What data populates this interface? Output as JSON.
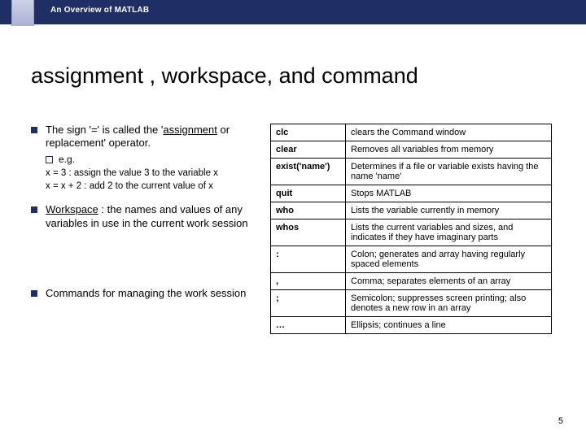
{
  "header": {
    "title": "An Overview of MATLAB"
  },
  "title": "assignment , workspace, and command",
  "bullets": [
    {
      "pre": "The sign '=' is called the '",
      "u": "assignment",
      "post": " or replacement' operator.",
      "sub": {
        "label": "e.g.",
        "lines": [
          "x = 3 : assign the value 3 to the variable x",
          "x = x + 2  :  add 2 to the current value of x"
        ]
      }
    },
    {
      "pre": "",
      "u": "Workspace",
      "post": " : the names and values of any variables in use in the current work session"
    },
    {
      "pre": "Commands for managing the work session",
      "u": "",
      "post": ""
    }
  ],
  "table": [
    {
      "cmd": "clc",
      "desc": "clears the Command window"
    },
    {
      "cmd": "clear",
      "desc": "Removes all variables from memory"
    },
    {
      "cmd": "exist('name')",
      "desc": "Determines if a file or variable exists having the name 'name'"
    },
    {
      "cmd": "quit",
      "desc": "Stops MATLAB"
    },
    {
      "cmd": "who",
      "desc": "Lists the variable currently in memory"
    },
    {
      "cmd": "whos",
      "desc": "Lists the current variables and sizes, and indicates if they have imaginary parts"
    },
    {
      "cmd": ":",
      "desc": "Colon; generates and array having regularly spaced elements"
    },
    {
      "cmd": ",",
      "desc": "Comma; separates elements of an array"
    },
    {
      "cmd": ";",
      "desc": "Semicolon; suppresses screen printing; also denotes a new row in an array"
    },
    {
      "cmd": "…",
      "desc": "Ellipsis; continues a line"
    }
  ],
  "page": "5"
}
